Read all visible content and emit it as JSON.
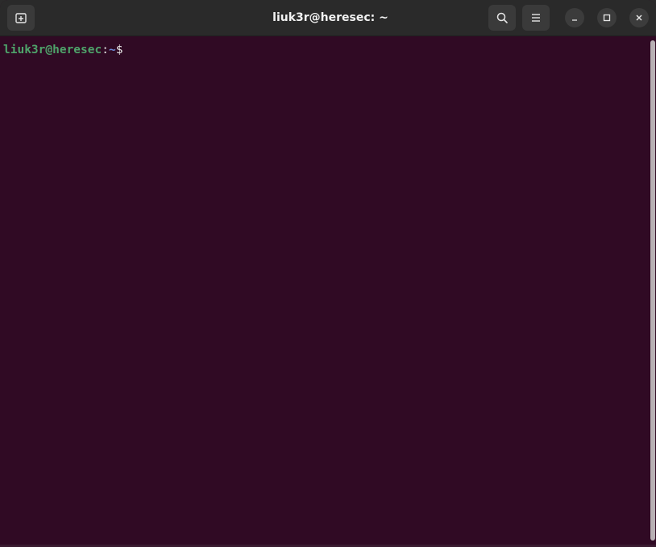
{
  "window": {
    "title": "liuk3r@heresec: ~"
  },
  "toolbar": {
    "new_tab_icon": "new-tab-icon",
    "search_icon": "search-icon",
    "menu_icon": "hamburger-menu-icon",
    "minimize_icon": "minimize-icon",
    "maximize_icon": "maximize-icon",
    "close_icon": "close-icon"
  },
  "terminal": {
    "prompt_user_host": "liuk3r@heresec",
    "prompt_colon": ":",
    "prompt_path": "~",
    "prompt_symbol": "$"
  },
  "colors": {
    "background": "#300a24",
    "user_host": "#4ea36a",
    "path": "#6f8bd6",
    "titlebar": "#2a2a2a"
  }
}
